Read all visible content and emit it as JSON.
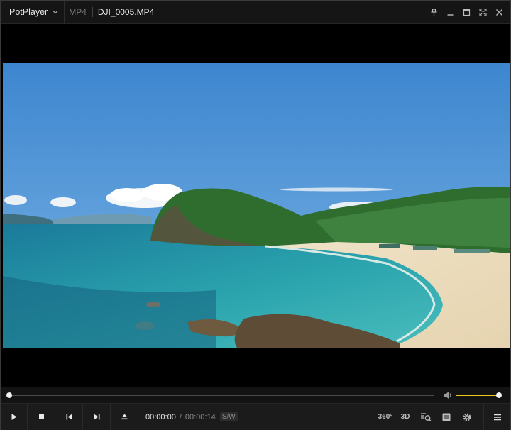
{
  "titlebar": {
    "app_name": "PotPlayer",
    "format": "MP4",
    "file_name": "DJI_0005.MP4",
    "controls": [
      "pin-icon",
      "minimize-icon",
      "maximize-icon",
      "fullscreen-icon",
      "close-icon"
    ]
  },
  "seek": {
    "progress": 0.0
  },
  "volume": {
    "level": 1.0,
    "accent": "#f0c81c"
  },
  "controls": {
    "buttons": [
      "play-icon",
      "stop-icon",
      "previous-icon",
      "next-icon",
      "eject-icon"
    ],
    "current_time": "00:00:00",
    "separator": "/",
    "total_time": "00:00:14",
    "decoder_badge": "S/W",
    "label_360": "360°",
    "label_3d": "3D",
    "right_icons": [
      "vr360-icon",
      "3d-icon",
      "search-frame-icon",
      "playlist-icon",
      "settings-icon",
      "menu-icon"
    ]
  },
  "colors": {
    "background": "#000000",
    "titlebar": "#151515",
    "controlbar": "#1b1b1b"
  }
}
